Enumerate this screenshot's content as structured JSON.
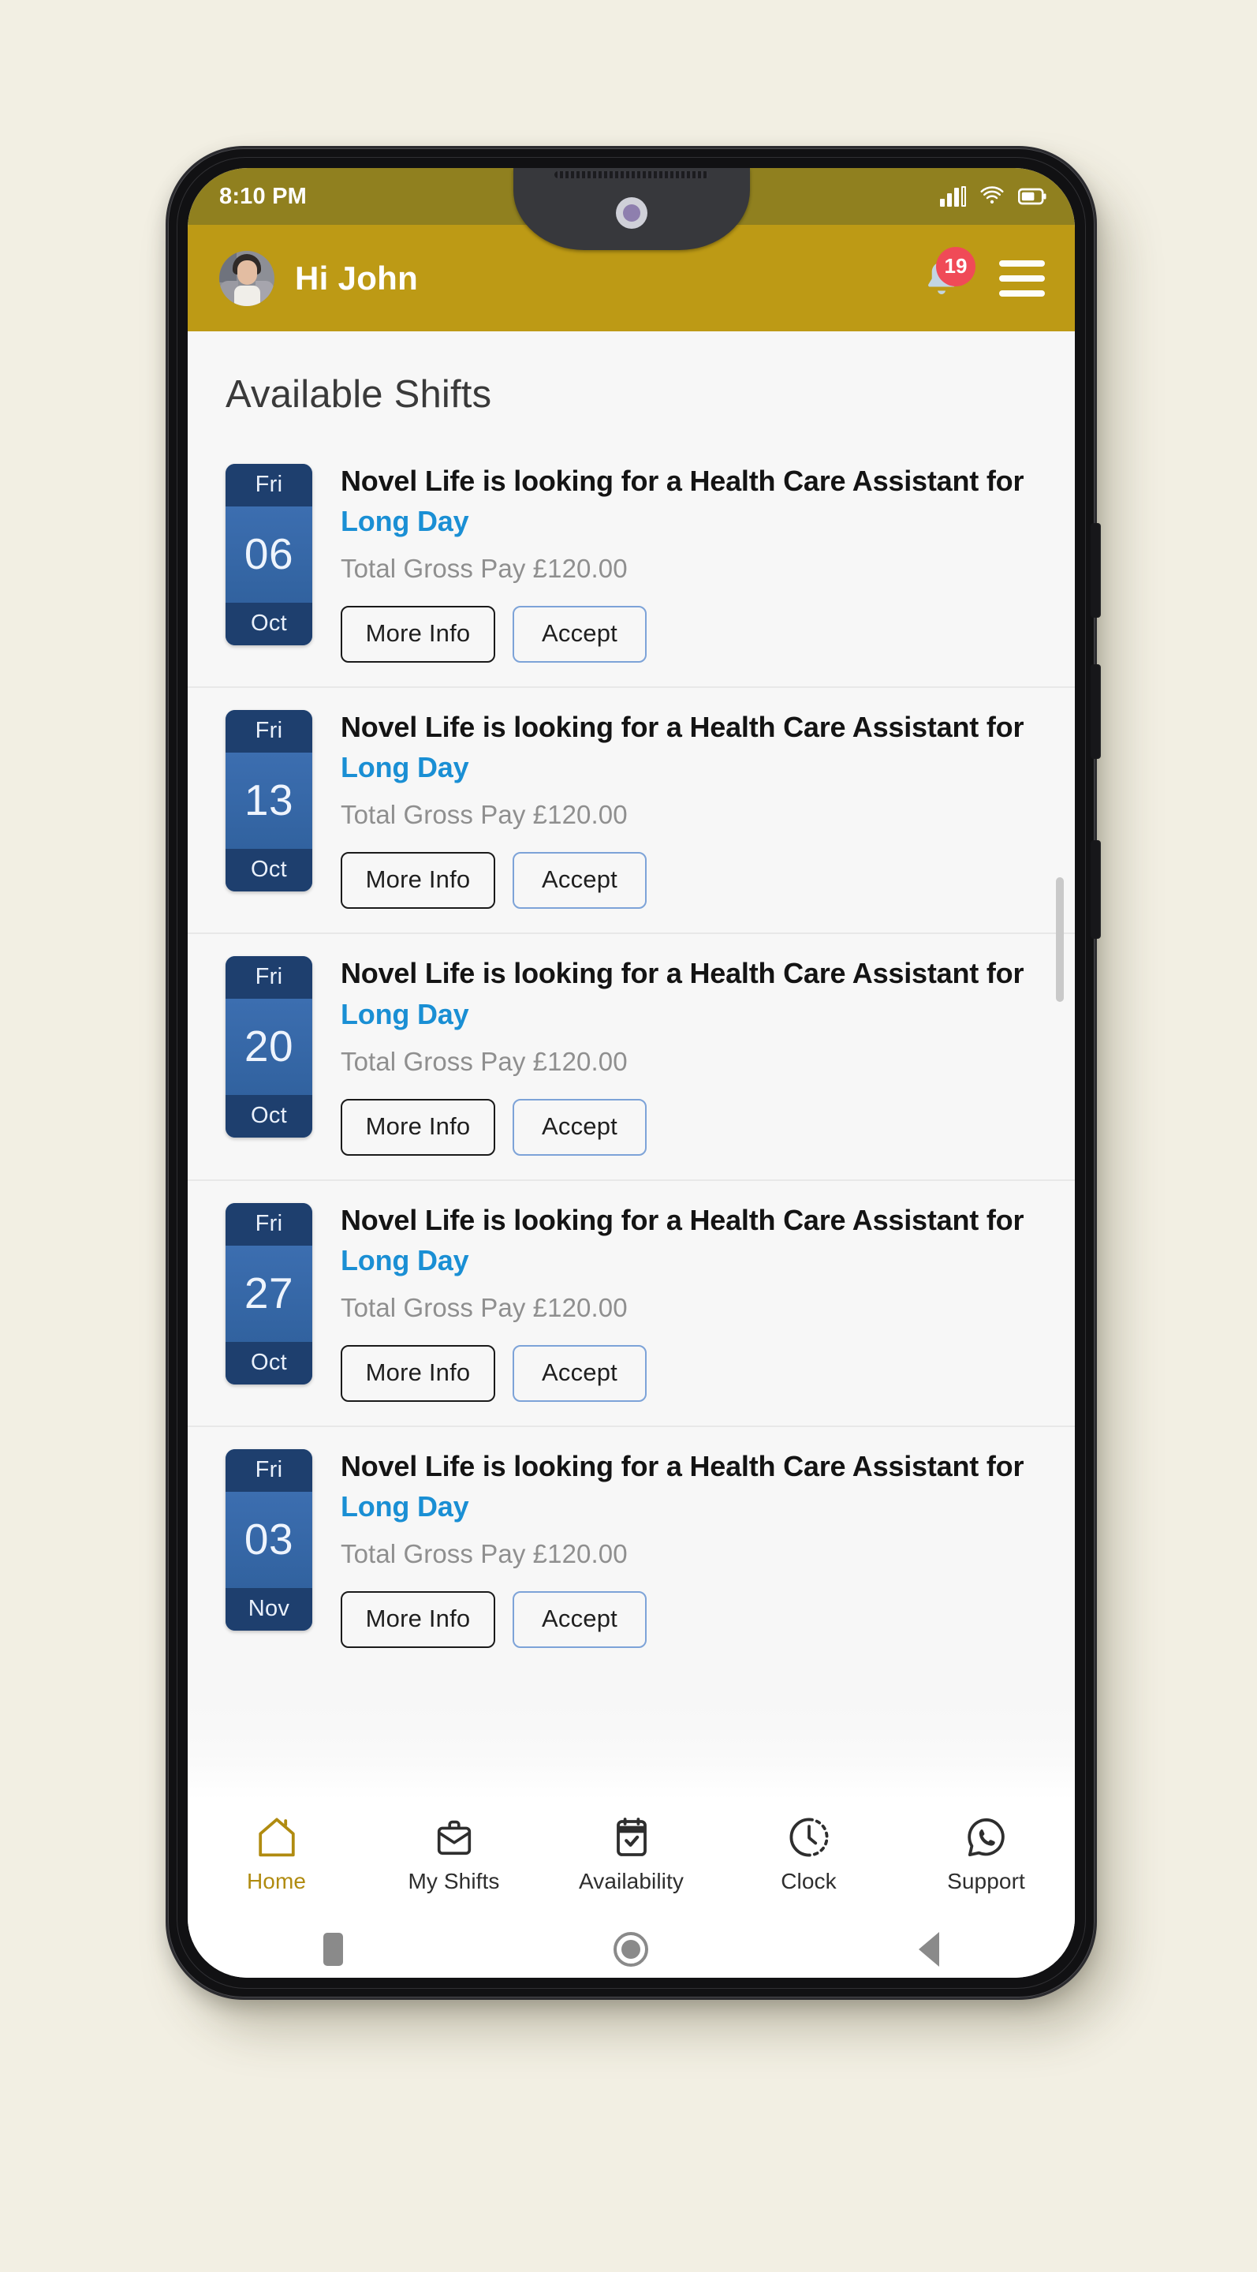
{
  "status_bar": {
    "time": "8:10 PM",
    "icons": [
      "signal-bars-icon",
      "wifi-icon",
      "battery-icon"
    ]
  },
  "header": {
    "greeting": "Hi John",
    "avatar_name": "user-avatar",
    "notification_icon": "bell-icon",
    "notification_count": "19",
    "menu_icon": "hamburger-menu-icon",
    "background_color": "#bd9a15",
    "badge_color": "#f04a57"
  },
  "main": {
    "title": "Available Shifts",
    "shifts": [
      {
        "dow": "Fri",
        "dom": "06",
        "mon": "Oct",
        "headline_prefix": "Novel Life is looking for a Health Care Assistant for ",
        "shift_type": "Long Day",
        "pay": "Total Gross Pay £120.00",
        "more_info_label": "More Info",
        "accept_label": "Accept"
      },
      {
        "dow": "Fri",
        "dom": "13",
        "mon": "Oct",
        "headline_prefix": "Novel Life is looking for a Health Care Assistant for ",
        "shift_type": "Long Day",
        "pay": "Total Gross Pay £120.00",
        "more_info_label": "More Info",
        "accept_label": "Accept"
      },
      {
        "dow": "Fri",
        "dom": "20",
        "mon": "Oct",
        "headline_prefix": "Novel Life is looking for a Health Care Assistant for ",
        "shift_type": "Long Day",
        "pay": "Total Gross Pay £120.00",
        "more_info_label": "More Info",
        "accept_label": "Accept"
      },
      {
        "dow": "Fri",
        "dom": "27",
        "mon": "Oct",
        "headline_prefix": "Novel Life is looking for a Health Care Assistant for ",
        "shift_type": "Long Day",
        "pay": "Total Gross Pay £120.00",
        "more_info_label": "More Info",
        "accept_label": "Accept"
      },
      {
        "dow": "Fri",
        "dom": "03",
        "mon": "Nov",
        "headline_prefix": "Novel Life is looking for a Health Care Assistant for ",
        "shift_type": "Long Day",
        "pay": "Total Gross Pay £120.00",
        "more_info_label": "More Info",
        "accept_label": "Accept"
      }
    ],
    "shift_type_color": "#1a8fd4",
    "date_badge_color": "#3a6bab",
    "date_badge_dark": "#1e3f6e"
  },
  "bottom_nav": {
    "active_color": "#b08b10",
    "items": [
      {
        "label": "Home",
        "icon": "home-icon",
        "active": true
      },
      {
        "label": "My Shifts",
        "icon": "briefcase-icon",
        "active": false
      },
      {
        "label": "Availability",
        "icon": "calendar-check-icon",
        "active": false
      },
      {
        "label": "Clock",
        "icon": "clock-icon",
        "active": false
      },
      {
        "label": "Support",
        "icon": "whatsapp-phone-icon",
        "active": false
      }
    ]
  },
  "android_nav": {
    "recents": "recents-square-icon",
    "home": "home-circle-icon",
    "back": "back-triangle-icon"
  }
}
